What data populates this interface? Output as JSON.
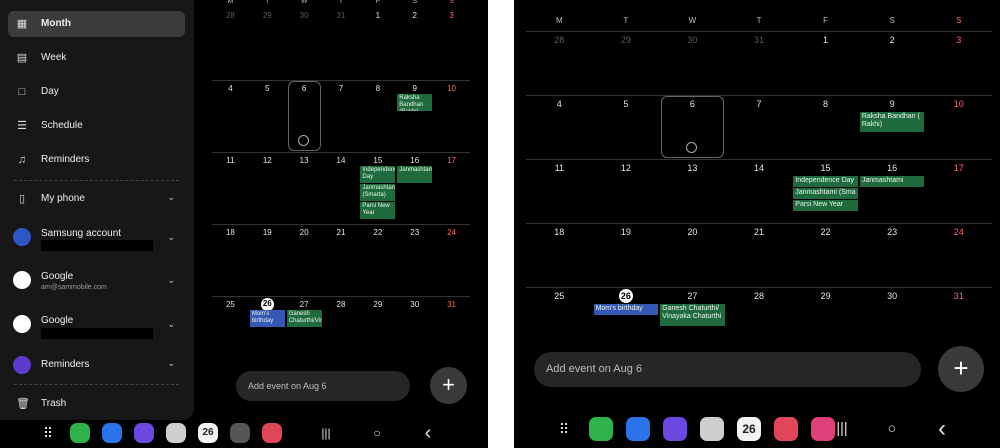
{
  "left": {
    "drawer": {
      "items": [
        {
          "label": "Month",
          "icon": "month-calendar-icon"
        },
        {
          "label": "Week",
          "icon": "week-calendar-icon"
        },
        {
          "label": "Day",
          "icon": "day-calendar-icon"
        },
        {
          "label": "Schedule",
          "icon": "schedule-list-icon"
        },
        {
          "label": "Reminders",
          "icon": "bell-icon"
        }
      ],
      "accounts": [
        {
          "label": "My phone",
          "sub": ""
        },
        {
          "label": "Samsung account",
          "sub": ""
        },
        {
          "label": "Google",
          "sub": "am@sammobile.com"
        },
        {
          "label": "Google",
          "sub": ""
        },
        {
          "label": "Reminders",
          "sub": ""
        }
      ],
      "trash_label": "Trash"
    },
    "dow": [
      "M",
      "T",
      "W",
      "T",
      "F",
      "S",
      "S"
    ],
    "add_event_placeholder": "Add event on Aug 6",
    "fab_symbol": "+"
  },
  "right": {
    "dow": [
      "M",
      "T",
      "W",
      "T",
      "F",
      "S",
      "S"
    ],
    "add_event_placeholder": "Add event on Aug 6",
    "fab_symbol": "+"
  },
  "weeks": [
    [
      "28",
      "29",
      "30",
      "31",
      "1",
      "2",
      "3"
    ],
    [
      "4",
      "5",
      "6",
      "7",
      "8",
      "9",
      "10"
    ],
    [
      "11",
      "12",
      "13",
      "14",
      "15",
      "16",
      "17"
    ],
    [
      "18",
      "19",
      "20",
      "21",
      "22",
      "23",
      "24"
    ],
    [
      "25",
      "26",
      "27",
      "28",
      "29",
      "30",
      "31"
    ]
  ],
  "events_left": {
    "raksha": "Raksha Bandhan (Rakhi)",
    "independence": "Independence Day",
    "janmashtami_sat": "Janmashtami",
    "janmashtami_smarta": "Janmashtami (Smarta)",
    "parsi": "Parsi New Year",
    "moms_birthday": "Mom's birthday",
    "ganesh": "Ganesh Chaturthi/Vinaya"
  },
  "events_right": {
    "raksha": "Raksha Bandhan ( Rakhi)",
    "independence": "Independence Day",
    "janmashtami_sat": "Janmashtami",
    "janmashtami_smarta": "Janmashtami (Sma",
    "parsi": "Parsi New Year",
    "moms_birthday": "Mom's birthday",
    "ganesh": "Ganesh Chaturthi/ Vinayaka Chaturthi"
  },
  "calendar_app_badge": "26",
  "colors": {
    "event_green": "#1f6b3e",
    "event_blue": "#3459b4",
    "weekend_red": "#ff6b6b"
  },
  "nav": {
    "recents_icon": "recents-icon",
    "home_icon": "home-icon",
    "back_icon": "back-icon"
  }
}
